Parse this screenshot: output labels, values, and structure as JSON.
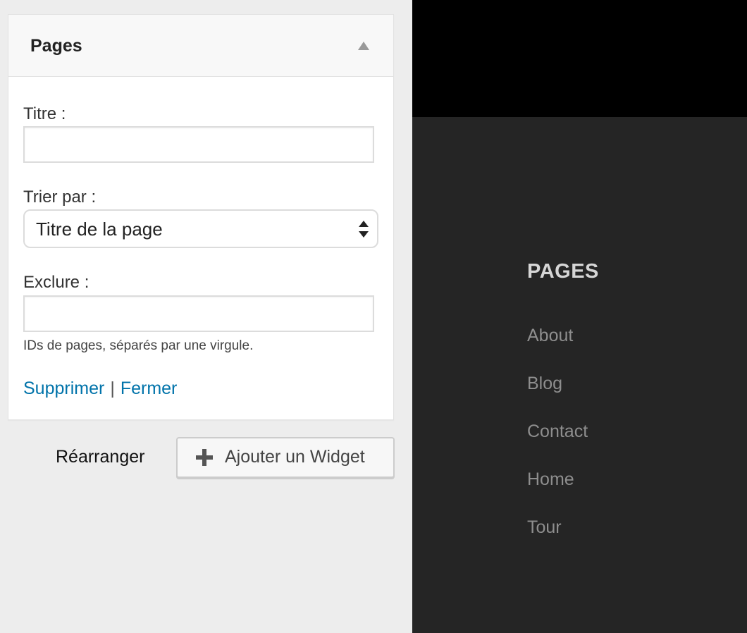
{
  "widget": {
    "title": "Pages",
    "fields": {
      "title_label": "Titre :",
      "title_value": "",
      "sort_label": "Trier par :",
      "sort_value": "Titre de la page",
      "exclude_label": "Exclure :",
      "exclude_value": "",
      "exclude_hint": "IDs de pages, séparés par une virgule."
    },
    "actions": {
      "delete": "Supprimer",
      "separator": "|",
      "close": "Fermer"
    }
  },
  "footer": {
    "reorder": "Réarranger",
    "add_widget": "Ajouter un Widget"
  },
  "preview": {
    "widget_title": "PAGES",
    "pages": [
      "About",
      "Blog",
      "Contact",
      "Home",
      "Tour"
    ]
  },
  "colors": {
    "link": "#0073aa",
    "preview_background": "#252525",
    "preview_header": "#000000"
  }
}
